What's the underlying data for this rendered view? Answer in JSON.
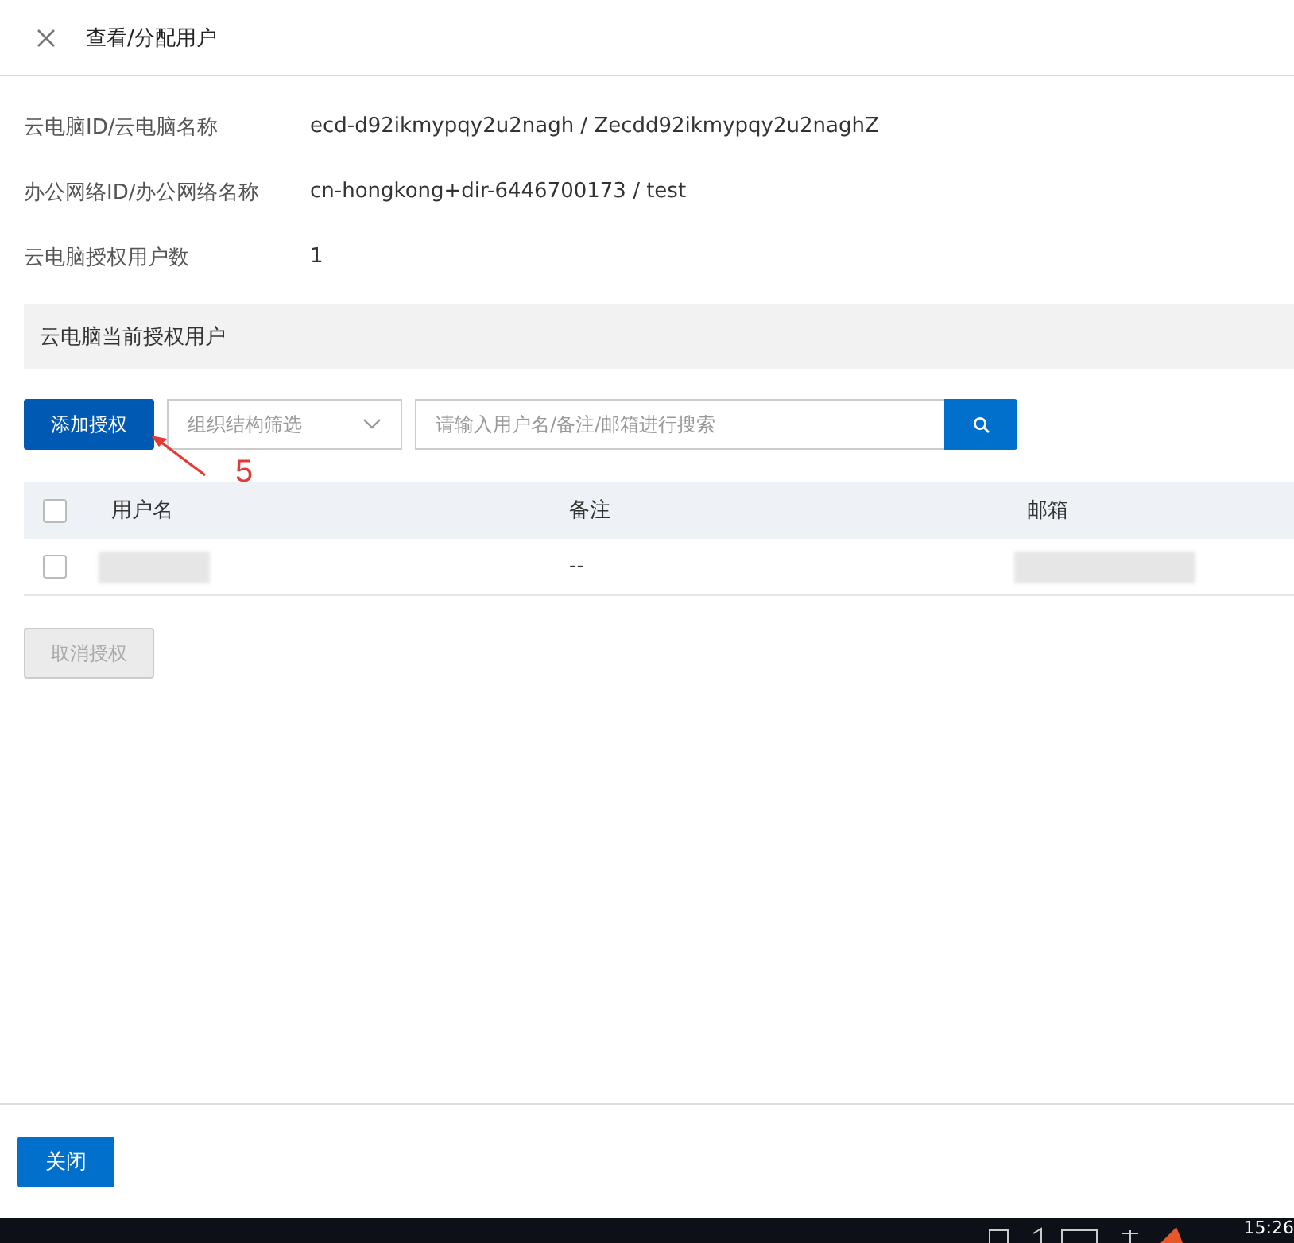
{
  "dialog": {
    "title": "查看/分配用户"
  },
  "details": [
    {
      "label": "云电脑ID/云电脑名称",
      "value": "ecd-d92ikmypqy2u2nagh / Zecdd92ikmypqy2u2naghZ"
    },
    {
      "label": "办公网络ID/办公网络名称",
      "value": "cn-hongkong+dir-6446700173 / test"
    },
    {
      "label": "云电脑授权用户数",
      "value": "1"
    }
  ],
  "section": {
    "title": "云电脑当前授权用户"
  },
  "toolbar": {
    "add_button": "添加授权",
    "filter": {
      "placeholder": "组织结构筛选"
    },
    "search": {
      "placeholder": "请输入用户名/备注/邮箱进行搜索"
    }
  },
  "annotation": {
    "label": "5"
  },
  "table": {
    "header_checked": false,
    "columns": [
      "用户名",
      "备注",
      "邮箱"
    ],
    "rows": [
      {
        "checked": false,
        "cells": [
          {
            "kind": "redacted"
          },
          {
            "kind": "text",
            "text": "--"
          },
          {
            "kind": "redacted"
          }
        ]
      }
    ]
  },
  "cancel_button": {
    "label": "取消授权",
    "disabled": true
  },
  "footer": {
    "close_button": "关闭"
  },
  "taskbar": {
    "clock": "15:26"
  }
}
